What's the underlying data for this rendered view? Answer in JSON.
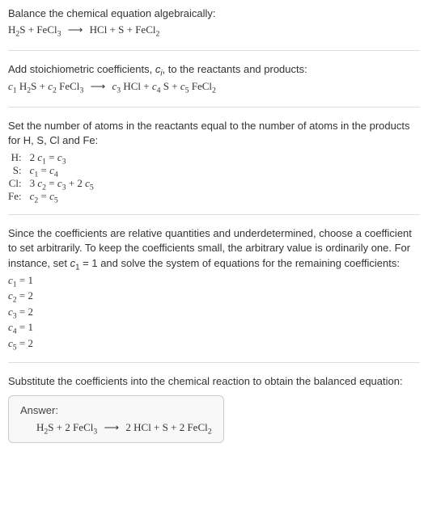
{
  "section1": {
    "instruction": "Balance the chemical equation algebraically:",
    "equation_html": "H<sub>2</sub>S + FeCl<sub>3</sub> <span class='arrow'>⟶</span> HCl + S + FeCl<sub>2</sub>"
  },
  "section2": {
    "instruction_html": "Add stoichiometric coefficients, <span class='italic'>c<sub>i</sub></span>, to the reactants and products:",
    "equation_html": "<span class='italic'>c</span><sub>1</sub> H<sub>2</sub>S + <span class='italic'>c</span><sub>2</sub> FeCl<sub>3</sub> <span class='arrow'>⟶</span> <span class='italic'>c</span><sub>3</sub> HCl + <span class='italic'>c</span><sub>4</sub> S + <span class='italic'>c</span><sub>5</sub> FeCl<sub>2</sub>"
  },
  "section3": {
    "instruction": "Set the number of atoms in the reactants equal to the number of atoms in the products for H, S, Cl and Fe:",
    "rows": [
      {
        "label": "H:",
        "eq_html": "2 <span class='italic'>c</span><sub>1</sub> = <span class='italic'>c</span><sub>3</sub>"
      },
      {
        "label": "S:",
        "eq_html": "<span class='italic'>c</span><sub>1</sub> = <span class='italic'>c</span><sub>4</sub>"
      },
      {
        "label": "Cl:",
        "eq_html": "3 <span class='italic'>c</span><sub>2</sub> = <span class='italic'>c</span><sub>3</sub> + 2 <span class='italic'>c</span><sub>5</sub>"
      },
      {
        "label": "Fe:",
        "eq_html": "<span class='italic'>c</span><sub>2</sub> = <span class='italic'>c</span><sub>5</sub>"
      }
    ]
  },
  "section4": {
    "instruction_html": "Since the coefficients are relative quantities and underdetermined, choose a coefficient to set arbitrarily. To keep the coefficients small, the arbitrary value is ordinarily one. For instance, set <span class='italic'>c</span><sub>1</sub> = 1 and solve the system of equations for the remaining coefficients:",
    "coefs": [
      "<span class='italic'>c</span><sub>1</sub> = 1",
      "<span class='italic'>c</span><sub>2</sub> = 2",
      "<span class='italic'>c</span><sub>3</sub> = 2",
      "<span class='italic'>c</span><sub>4</sub> = 1",
      "<span class='italic'>c</span><sub>5</sub> = 2"
    ]
  },
  "section5": {
    "instruction": "Substitute the coefficients into the chemical reaction to obtain the balanced equation:",
    "answer_label": "Answer:",
    "answer_eq_html": "H<sub>2</sub>S + 2 FeCl<sub>3</sub> <span class='arrow'>⟶</span> 2 HCl + S + 2 FeCl<sub>2</sub>"
  }
}
